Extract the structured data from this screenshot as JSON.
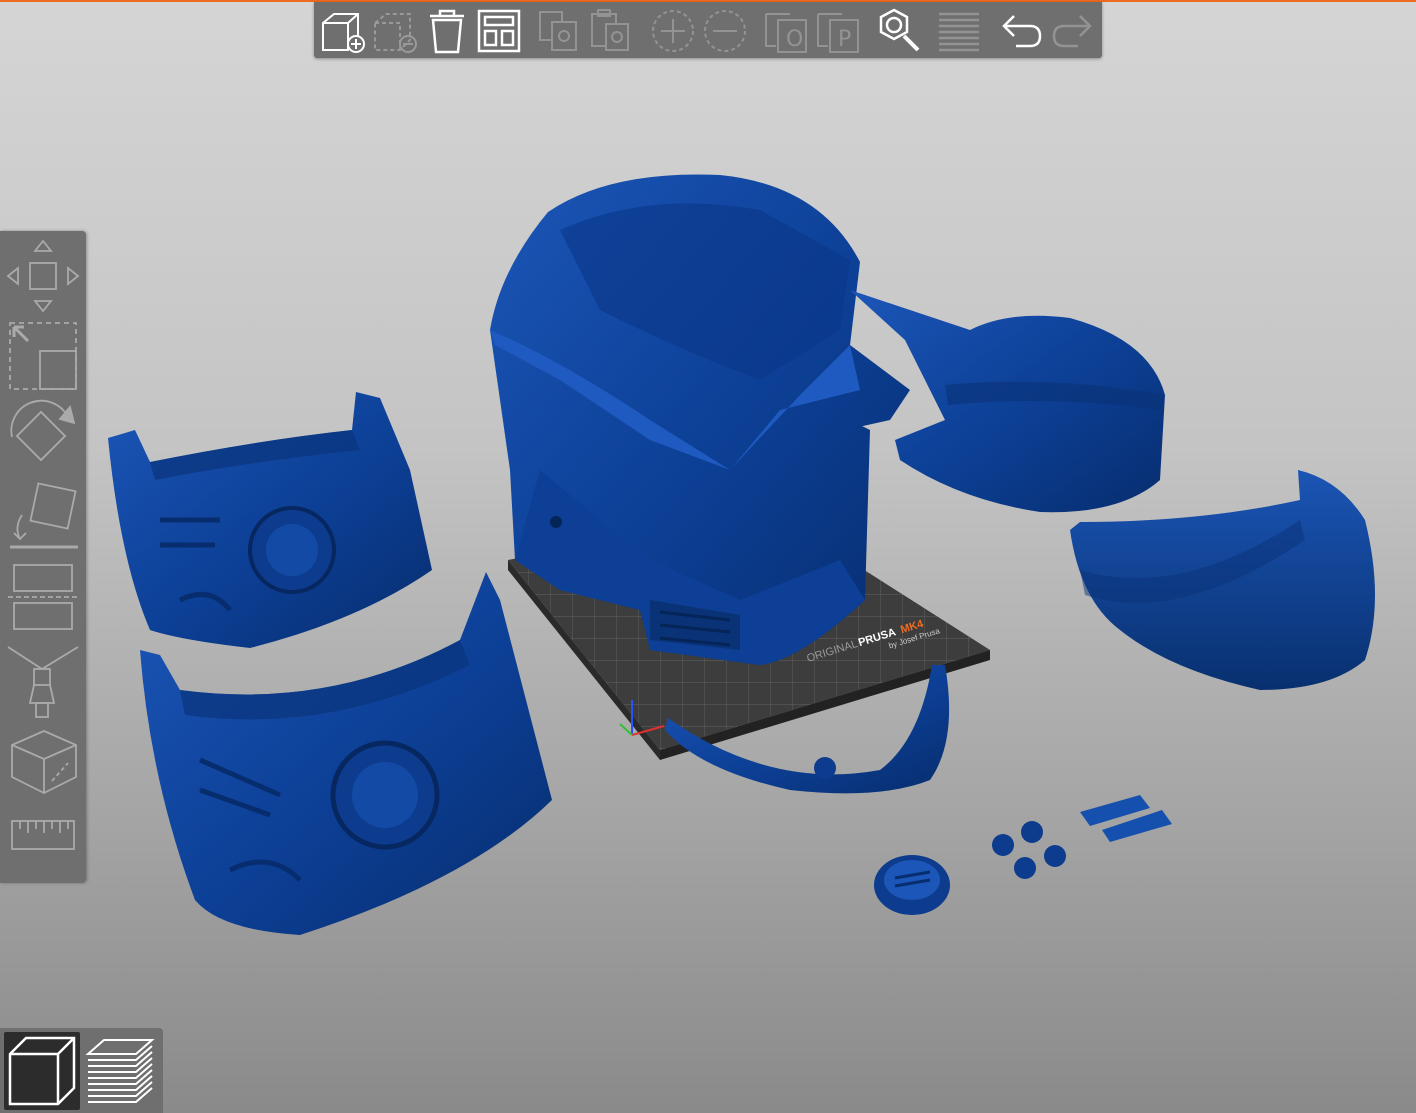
{
  "app": {
    "accent_color": "#ed6b21",
    "toolbar_bg": "#6f6f6f",
    "model_color": "#0b3a86"
  },
  "top_toolbar": [
    {
      "id": "add",
      "icon": "add-object-icon",
      "enabled": true
    },
    {
      "id": "delete",
      "icon": "delete-object-icon",
      "enabled": false
    },
    {
      "id": "delete_all",
      "icon": "delete-all-icon",
      "enabled": true
    },
    {
      "id": "arrange",
      "icon": "arrange-icon",
      "enabled": true
    },
    {
      "id": "copy",
      "icon": "copy-icon",
      "enabled": false
    },
    {
      "id": "paste",
      "icon": "paste-icon",
      "enabled": false
    },
    {
      "id": "add_instance",
      "icon": "add-instance-icon",
      "enabled": false
    },
    {
      "id": "remove_instance",
      "icon": "remove-instance-icon",
      "enabled": false
    },
    {
      "id": "split_objects",
      "icon": "split-objects-icon",
      "enabled": false
    },
    {
      "id": "split_parts",
      "icon": "split-parts-icon",
      "enabled": false
    },
    {
      "id": "search",
      "icon": "search-icon",
      "enabled": true
    },
    {
      "id": "layers",
      "icon": "variable-layer-height-icon",
      "enabled": false
    },
    {
      "id": "undo",
      "icon": "undo-icon",
      "enabled": true
    },
    {
      "id": "redo",
      "icon": "redo-icon",
      "enabled": false
    }
  ],
  "left_toolbar": [
    {
      "id": "move",
      "icon": "move-icon"
    },
    {
      "id": "scale",
      "icon": "scale-icon"
    },
    {
      "id": "rotate",
      "icon": "rotate-icon"
    },
    {
      "id": "place_on_face",
      "icon": "place-on-face-icon"
    },
    {
      "id": "cut",
      "icon": "cut-icon"
    },
    {
      "id": "paint",
      "icon": "paint-icon"
    },
    {
      "id": "measure_cube",
      "icon": "cube-seam-icon"
    },
    {
      "id": "measure",
      "icon": "ruler-icon"
    }
  ],
  "view_toggle": [
    {
      "id": "3d_view",
      "icon": "3d-view-icon",
      "active": true
    },
    {
      "id": "preview",
      "icon": "layers-preview-icon",
      "active": false
    }
  ],
  "bed": {
    "label_original": "ORIGINAL",
    "label_brand": "PRUSA",
    "label_model": "MK4",
    "label_by": "by Josef Prusa"
  }
}
